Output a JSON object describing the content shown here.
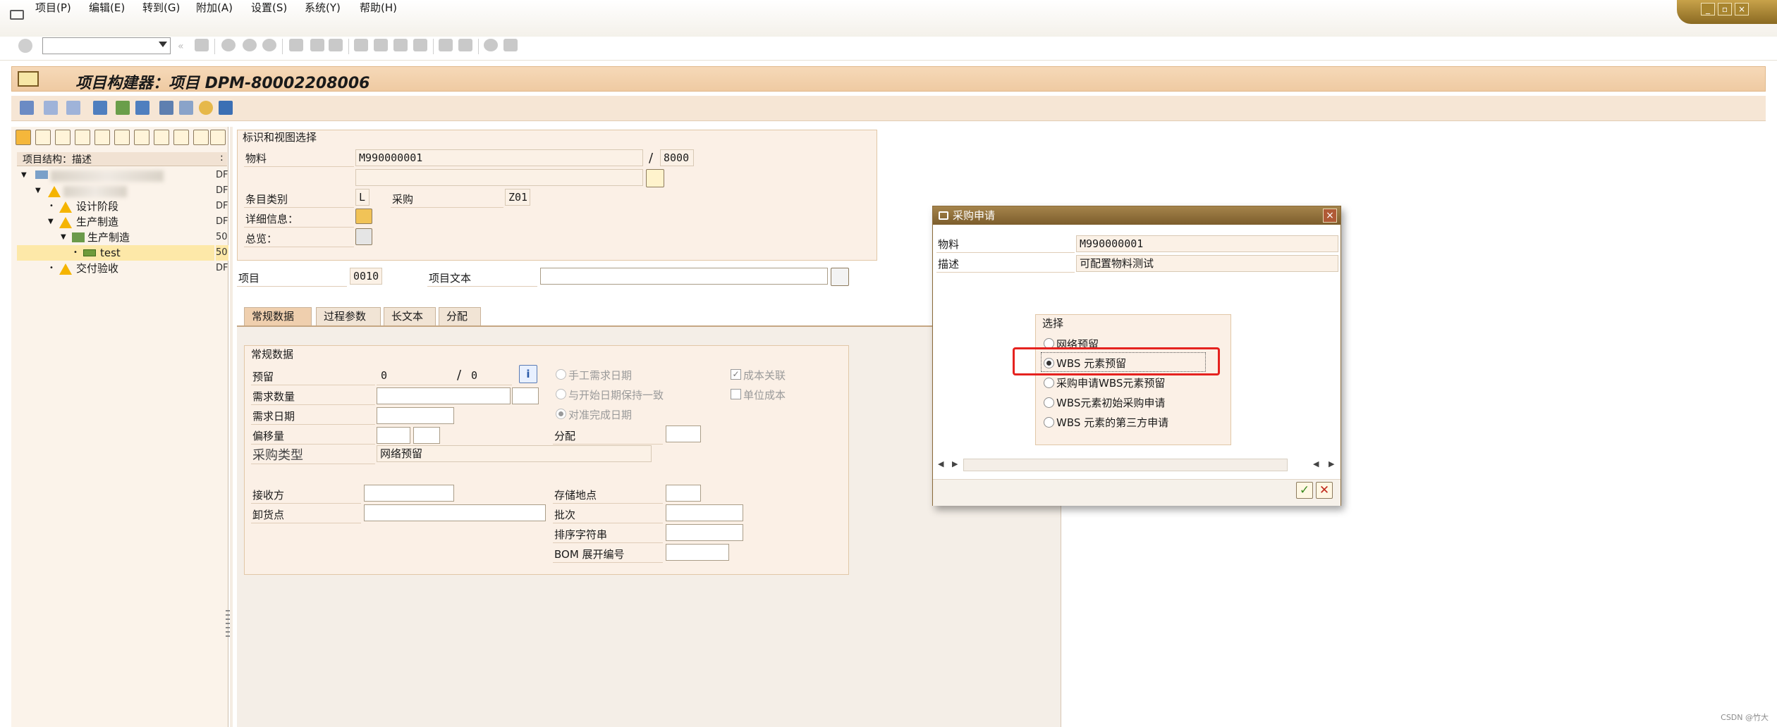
{
  "menubar": {
    "items": [
      "项目(P)",
      "编辑(E)",
      "转到(G)",
      "附加(A)",
      "设置(S)",
      "系统(Y)",
      "帮助(H)"
    ]
  },
  "window_controls": [
    "minimize-icon",
    "restore-icon",
    "close-icon"
  ],
  "title": "项目构建器：项目 DPM-80002208006",
  "tree": {
    "header": "项目结构：描述",
    "rows": [
      {
        "label": "",
        "col2": "DF"
      },
      {
        "label": "",
        "col2": "DF"
      },
      {
        "label": "设计阶段",
        "col2": "DF"
      },
      {
        "label": "生产制造",
        "col2": "DF"
      },
      {
        "label": "生产制造",
        "col2": "50"
      },
      {
        "label": "test",
        "col2": "50"
      },
      {
        "label": "交付验收",
        "col2": "DF"
      }
    ]
  },
  "ident": {
    "title": "标识和视图选择",
    "material_label": "物料",
    "material_value": "M990000001",
    "plant_value": "8000",
    "item_cat_label": "条目类别",
    "item_cat_value": "L",
    "purchase_label": "采购",
    "purchase_value": "Z01",
    "detail_label": "详细信息：",
    "overview_label": "总览：",
    "item_label": "项目",
    "item_value": "0010",
    "item_text_label": "项目文本",
    "slash": "/"
  },
  "tabs": [
    "常规数据",
    "过程参数",
    "长文本",
    "分配"
  ],
  "general": {
    "title": "常规数据",
    "reservation_label": "预留",
    "reservation_value": "0",
    "reservation_value2": "0",
    "req_qty_label": "需求数量",
    "req_date_label": "需求日期",
    "offset_label": "偏移量",
    "proc_type_label": "采购类型",
    "proc_type_value": "网络预留",
    "receiver_label": "接收方",
    "unloading_label": "卸货点",
    "manual_req_date": "手工需求日期",
    "align_start_date": "与开始日期保持一致",
    "align_finish_date": "对准完成日期",
    "distribution_label": "分配",
    "cost_relevant": "成本关联",
    "unit_cost": "单位成本",
    "storage_loc_label": "存储地点",
    "batch_label": "批次",
    "sort_string_label": "排序字符串",
    "bom_explosion_label": "BOM 展开编号"
  },
  "dialog": {
    "title": "采购申请",
    "material_label": "物料",
    "material_value": "M990000001",
    "desc_label": "描述",
    "desc_value": "可配置物料测试",
    "selection_title": "选择",
    "options": [
      "网络预留",
      "WBS 元素预留",
      "采购申请WBS元素预留",
      "WBS元素初始采购申请",
      "WBS 元素的第三方申请"
    ],
    "selected_index": 1
  },
  "watermark": "CSDN @竹大"
}
